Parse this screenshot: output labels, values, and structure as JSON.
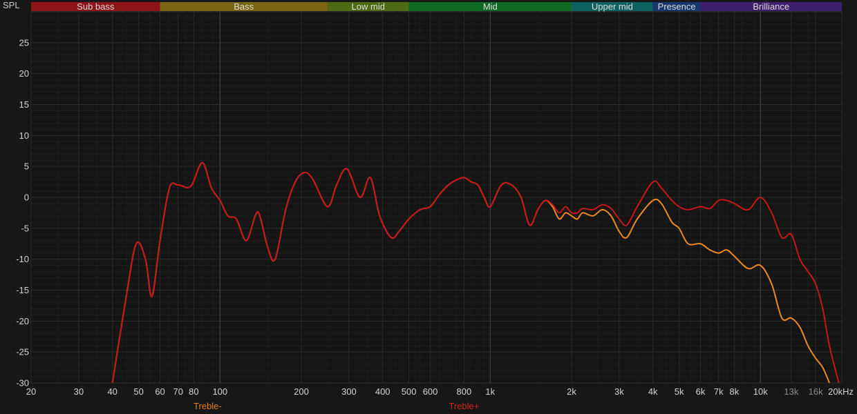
{
  "chart_data": {
    "type": "line",
    "ylabel": "SPL",
    "xscale": "log",
    "xlim": [
      20,
      20000
    ],
    "ylim": [
      -30,
      30
    ],
    "grid": true,
    "bands": [
      {
        "label": "Sub bass",
        "from": 20,
        "to": 60,
        "color": "#8e1418"
      },
      {
        "label": "Bass",
        "from": 60,
        "to": 250,
        "color": "#7c6512"
      },
      {
        "label": "Low mid",
        "from": 250,
        "to": 500,
        "color": "#4e6b13"
      },
      {
        "label": "Mid",
        "from": 500,
        "to": 2000,
        "color": "#0f6a24"
      },
      {
        "label": "Upper mid",
        "from": 2000,
        "to": 4000,
        "color": "#0e6362"
      },
      {
        "label": "Presence",
        "from": 4000,
        "to": 6000,
        "color": "#16386f"
      },
      {
        "label": "Brilliance",
        "from": 6000,
        "to": 20000,
        "color": "#3d1f6e"
      }
    ],
    "x_ticks": [
      {
        "v": 20,
        "label": "20"
      },
      {
        "v": 30,
        "label": "30"
      },
      {
        "v": 40,
        "label": "40"
      },
      {
        "v": 50,
        "label": "50"
      },
      {
        "v": 60,
        "label": "60"
      },
      {
        "v": 70,
        "label": "70"
      },
      {
        "v": 80,
        "label": "80"
      },
      {
        "v": 100,
        "label": "100"
      },
      {
        "v": 200,
        "label": "200"
      },
      {
        "v": 300,
        "label": "300"
      },
      {
        "v": 400,
        "label": "400"
      },
      {
        "v": 500,
        "label": "500"
      },
      {
        "v": 600,
        "label": "600"
      },
      {
        "v": 800,
        "label": "800"
      },
      {
        "v": 1000,
        "label": "1k"
      },
      {
        "v": 2000,
        "label": "2k"
      },
      {
        "v": 3000,
        "label": "3k"
      },
      {
        "v": 4000,
        "label": "4k"
      },
      {
        "v": 5000,
        "label": "5k"
      },
      {
        "v": 6000,
        "label": "6k"
      },
      {
        "v": 7000,
        "label": "7k"
      },
      {
        "v": 8000,
        "label": "8k"
      },
      {
        "v": 10000,
        "label": "10k"
      },
      {
        "v": 13000,
        "label": "13k",
        "dim": true
      },
      {
        "v": 16000,
        "label": "16k",
        "dim": true
      },
      {
        "v": 20000,
        "label": "20kHz"
      }
    ],
    "y_ticks": [
      25,
      20,
      15,
      10,
      5,
      0,
      -5,
      -10,
      -15,
      -20,
      -25,
      -30
    ],
    "markers": [
      {
        "label": "Treble-",
        "x": 90,
        "color": "#e8821e"
      },
      {
        "label": "Treble+",
        "x": 800,
        "color": "#d0261c"
      }
    ],
    "series": [
      {
        "name": "Treble-",
        "color": "#ee8a1f",
        "points": [
          [
            40,
            -30
          ],
          [
            45,
            -16
          ],
          [
            49,
            -7.5
          ],
          [
            53,
            -10
          ],
          [
            56,
            -16
          ],
          [
            60,
            -7
          ],
          [
            65,
            1.5
          ],
          [
            70,
            2
          ],
          [
            78,
            1.8
          ],
          [
            86,
            5.6
          ],
          [
            93,
            1.5
          ],
          [
            100,
            -0.5
          ],
          [
            107,
            -3
          ],
          [
            115,
            -3.5
          ],
          [
            125,
            -7
          ],
          [
            135,
            -3
          ],
          [
            140,
            -2.8
          ],
          [
            150,
            -8
          ],
          [
            160,
            -10
          ],
          [
            175,
            -2
          ],
          [
            190,
            2.5
          ],
          [
            205,
            4
          ],
          [
            220,
            3
          ],
          [
            250,
            -1.5
          ],
          [
            270,
            2
          ],
          [
            295,
            4.6
          ],
          [
            330,
            0
          ],
          [
            360,
            3.2
          ],
          [
            390,
            -3
          ],
          [
            430,
            -6.5
          ],
          [
            460,
            -5.5
          ],
          [
            500,
            -3.5
          ],
          [
            550,
            -2
          ],
          [
            600,
            -1.5
          ],
          [
            650,
            0.5
          ],
          [
            700,
            2
          ],
          [
            750,
            2.8
          ],
          [
            800,
            3.2
          ],
          [
            850,
            2.5
          ],
          [
            900,
            2
          ],
          [
            950,
            0
          ],
          [
            1000,
            -1.5
          ],
          [
            1100,
            2
          ],
          [
            1200,
            2
          ],
          [
            1300,
            0
          ],
          [
            1400,
            -4.5
          ],
          [
            1500,
            -2
          ],
          [
            1600,
            -0.5
          ],
          [
            1700,
            -1.5
          ],
          [
            1800,
            -3.5
          ],
          [
            1900,
            -2.5
          ],
          [
            2000,
            -3
          ],
          [
            2100,
            -3.5
          ],
          [
            2200,
            -2.5
          ],
          [
            2400,
            -3
          ],
          [
            2600,
            -2
          ],
          [
            2800,
            -3
          ],
          [
            3000,
            -5.5
          ],
          [
            3200,
            -6.5
          ],
          [
            3500,
            -3.5
          ],
          [
            4000,
            -0.5
          ],
          [
            4300,
            -1
          ],
          [
            4700,
            -4
          ],
          [
            5000,
            -5
          ],
          [
            5400,
            -7.5
          ],
          [
            6000,
            -7.5
          ],
          [
            6500,
            -8.5
          ],
          [
            7000,
            -9
          ],
          [
            7500,
            -8.5
          ],
          [
            8000,
            -9.5
          ],
          [
            9000,
            -11.5
          ],
          [
            10000,
            -11
          ],
          [
            11000,
            -14
          ],
          [
            12000,
            -19.5
          ],
          [
            13000,
            -19.5
          ],
          [
            14000,
            -21
          ],
          [
            15000,
            -24
          ],
          [
            16000,
            -26
          ],
          [
            17000,
            -27.5
          ],
          [
            18000,
            -30
          ]
        ]
      },
      {
        "name": "Treble+",
        "color": "#c8161a",
        "points": [
          [
            40,
            -30
          ],
          [
            45,
            -16
          ],
          [
            49,
            -7.5
          ],
          [
            53,
            -10
          ],
          [
            56,
            -16
          ],
          [
            60,
            -7
          ],
          [
            65,
            1.5
          ],
          [
            70,
            2
          ],
          [
            78,
            1.8
          ],
          [
            86,
            5.6
          ],
          [
            93,
            1.5
          ],
          [
            100,
            -0.5
          ],
          [
            107,
            -3
          ],
          [
            115,
            -3.5
          ],
          [
            125,
            -7
          ],
          [
            135,
            -3
          ],
          [
            140,
            -2.8
          ],
          [
            150,
            -8
          ],
          [
            160,
            -10
          ],
          [
            175,
            -2
          ],
          [
            190,
            2.5
          ],
          [
            205,
            4
          ],
          [
            220,
            3
          ],
          [
            250,
            -1.5
          ],
          [
            270,
            2
          ],
          [
            295,
            4.6
          ],
          [
            330,
            0
          ],
          [
            360,
            3.2
          ],
          [
            390,
            -3
          ],
          [
            430,
            -6.5
          ],
          [
            460,
            -5.5
          ],
          [
            500,
            -3.5
          ],
          [
            550,
            -2
          ],
          [
            600,
            -1.5
          ],
          [
            650,
            0.5
          ],
          [
            700,
            2
          ],
          [
            750,
            2.8
          ],
          [
            800,
            3.2
          ],
          [
            850,
            2.5
          ],
          [
            900,
            2
          ],
          [
            950,
            0
          ],
          [
            1000,
            -1.5
          ],
          [
            1100,
            2
          ],
          [
            1200,
            2
          ],
          [
            1300,
            0
          ],
          [
            1400,
            -4.5
          ],
          [
            1500,
            -2
          ],
          [
            1600,
            -0.5
          ],
          [
            1700,
            -1.2
          ],
          [
            1800,
            -2.5
          ],
          [
            1900,
            -1.5
          ],
          [
            2000,
            -2.5
          ],
          [
            2100,
            -2.5
          ],
          [
            2200,
            -1.8
          ],
          [
            2400,
            -2
          ],
          [
            2600,
            -1.2
          ],
          [
            2800,
            -1.8
          ],
          [
            3000,
            -3.5
          ],
          [
            3200,
            -4.5
          ],
          [
            3500,
            -1.5
          ],
          [
            4000,
            2.5
          ],
          [
            4300,
            1.5
          ],
          [
            4700,
            -0.5
          ],
          [
            5000,
            -1.5
          ],
          [
            5400,
            -2
          ],
          [
            6000,
            -1.5
          ],
          [
            6500,
            -1.8
          ],
          [
            7000,
            -0.5
          ],
          [
            7500,
            -0.5
          ],
          [
            8000,
            -1
          ],
          [
            9000,
            -2
          ],
          [
            10000,
            0
          ],
          [
            11000,
            -2.5
          ],
          [
            12000,
            -6.5
          ],
          [
            13000,
            -6
          ],
          [
            14000,
            -10
          ],
          [
            15000,
            -12
          ],
          [
            16000,
            -14
          ],
          [
            17000,
            -18
          ],
          [
            18000,
            -24
          ],
          [
            19500,
            -30
          ]
        ]
      }
    ]
  }
}
